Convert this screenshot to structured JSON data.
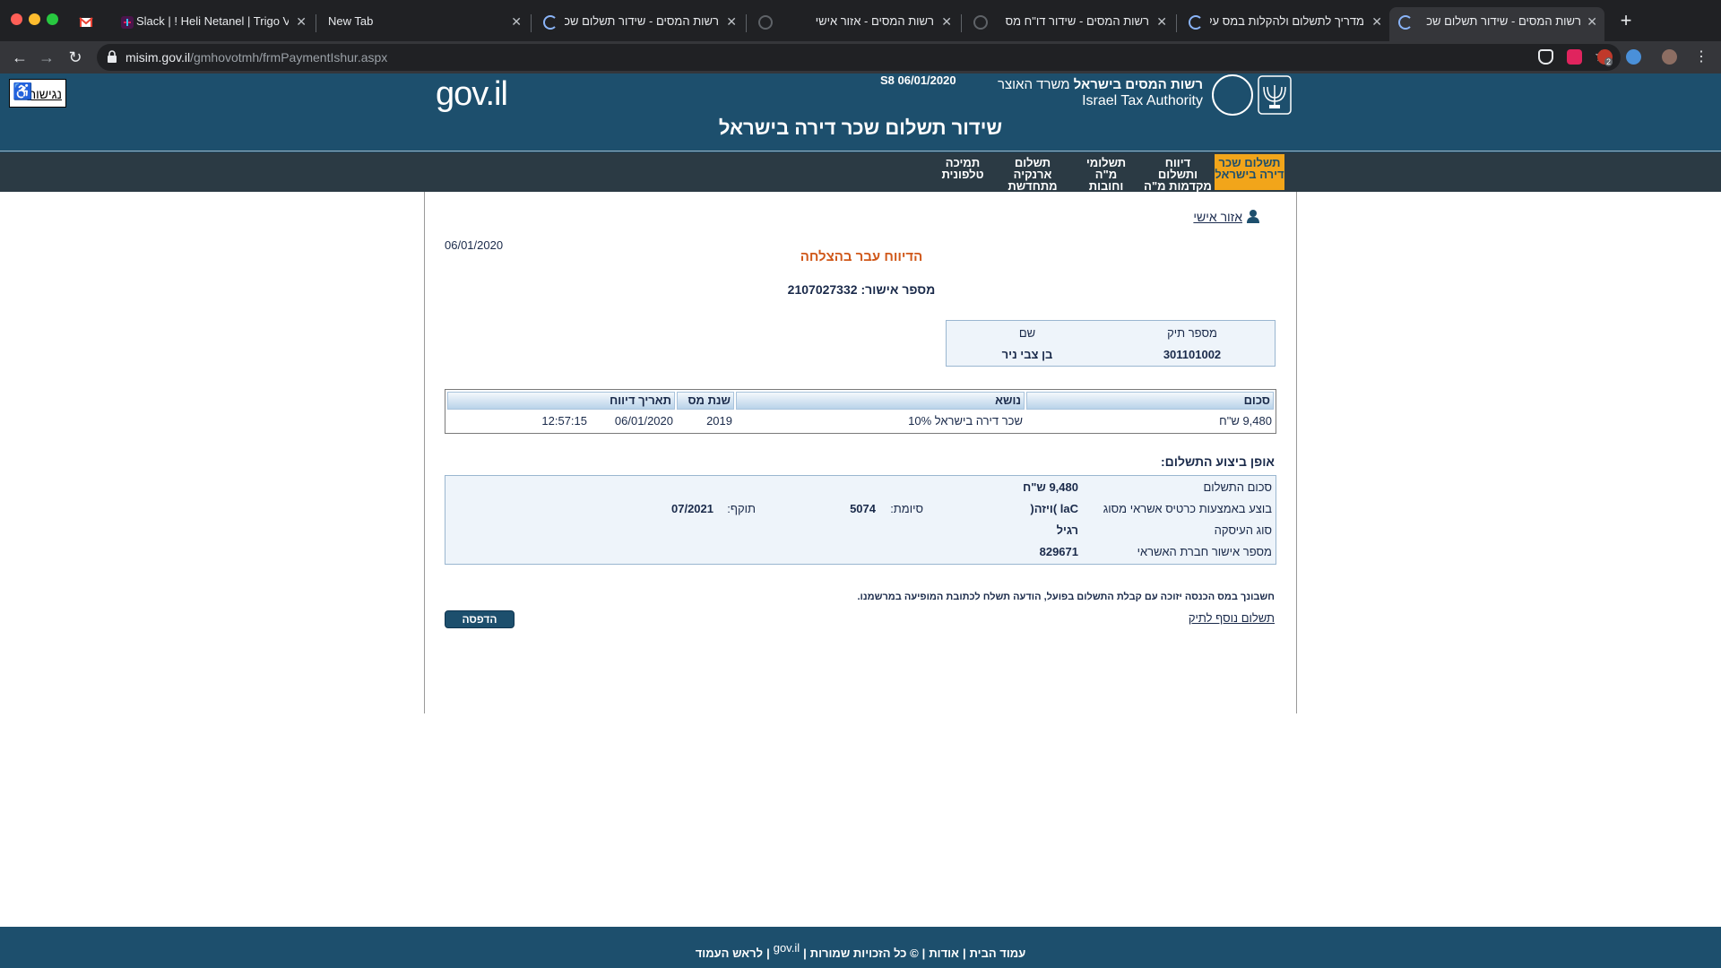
{
  "browser": {
    "tabs": [
      {
        "title": "",
        "icon": "gmail-icon"
      },
      {
        "title": "Slack | ! Heli Netanel | Trigo Vi",
        "icon": "slack-icon"
      },
      {
        "title": "New Tab",
        "icon": ""
      },
      {
        "title": "רשות המסים - שידור תשלום שכ",
        "icon": "loading-icon"
      },
      {
        "title": "רשות המסים - אזור אישי",
        "icon": "globe-icon"
      },
      {
        "title": "רשות המסים - שידור דו\"ח מס",
        "icon": "globe-icon"
      },
      {
        "title": "מדריך לתשלום ולהקלות במס על",
        "icon": "loading-icon"
      },
      {
        "title": "רשות המסים - שידור תשלום שכ",
        "icon": "loading-icon",
        "active": true
      }
    ],
    "new_tab_label": "+",
    "url_host": "misim.gov.il",
    "url_path": "/gmhovotmh/frmPaymentIshur.aspx",
    "extension_badge": "2"
  },
  "header": {
    "accessibility_label": "נגישות",
    "gov_logo": "gov.il",
    "session_info": "S8 06/01/2020",
    "authority_name_bold": "רשות המסים בישראל",
    "ministry_name": "משרד האוצר",
    "authority_name_en": "Israel Tax Authority",
    "page_title": "שידור תשלום שכר דירה בישראל"
  },
  "nav": {
    "items": [
      {
        "line1": "תשלום שכר",
        "line2": "דירה בישראל",
        "active": true
      },
      {
        "line1": "דיווח ותשלום",
        "line2": "מקדמות מ\"ה"
      },
      {
        "line1": "תשלומי מ\"ה",
        "line2": "וחובות"
      },
      {
        "line1": "תשלום ארנקיה",
        "line2": "מתחדשת"
      },
      {
        "line1": "תמיכה",
        "line2": "טלפונית"
      }
    ]
  },
  "main": {
    "personal_area": "אזור אישי",
    "date": "06/01/2020",
    "success_message": "הדיווח עבר בהצלחה",
    "approval_label": "מספר אישור:",
    "approval_number": "2107027332",
    "file_box": {
      "file_label": "מספר תיק",
      "file_value": "301101002",
      "name_label": "שם",
      "name_value": "בן צבי ניר"
    },
    "report_table": {
      "headers": [
        "סכום",
        "נושא",
        "שנת מס",
        "תאריך דיווח"
      ],
      "row": {
        "amount": "9,480 ש\"ח",
        "subject": "שכר דירה בישראל 10%",
        "tax_year": "2019",
        "report_date": "06/01/2020",
        "report_time": "12:57:15"
      }
    },
    "payment_method": {
      "title": "אופן ביצוע התשלום:",
      "amount_label": "סכום התשלום",
      "amount_value": "9,480 ש\"ח",
      "card_label": "בוצע באמצעות כרטיס אשראי מסוג",
      "card_value": "laC )ויזה(",
      "ending_label": "סיומת:",
      "ending_value": "5074",
      "valid_label": "תוקף:",
      "valid_value": "07/2021",
      "deal_type_label": "סוג העיסקה",
      "deal_type_value": "רגיל",
      "credit_approval_label": "מספר אישור חברת האשראי",
      "credit_approval_value": "829671"
    },
    "notice": "חשבונך במס הכנסה יזוכה עם קבלת התשלום בפועל, הודעה תשלח לכתובת המופיעה במרשמנו.",
    "another_payment_link": "תשלום נוסף לתיק",
    "print_button": "הדפסה"
  },
  "footer": {
    "home": "עמוד הבית",
    "about": "אודות",
    "rights": "© כל הזכויות שמורות",
    "gov_logo": "gov.il",
    "top": "לראש העמוד"
  },
  "colors": {
    "header_bg": "#1d4f6d",
    "nav_bg": "#2b3a44",
    "nav_active": "#f2a51a",
    "success": "#d0581a"
  }
}
